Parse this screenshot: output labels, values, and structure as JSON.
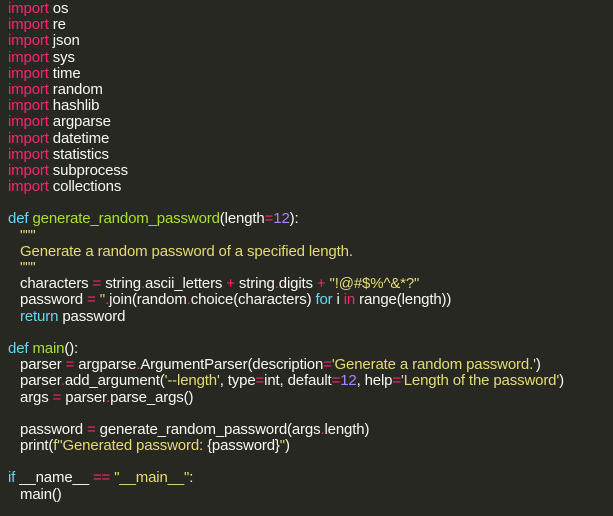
{
  "colors": {
    "background": "#272822",
    "text": "#f8f8f2",
    "keyword": "#f92672",
    "storage": "#66d9ef",
    "function": "#a6e22e",
    "number": "#ae81ff",
    "string": "#e6db74"
  },
  "lines": [
    {
      "indent": 0,
      "tokens": [
        [
          "kw",
          "import"
        ],
        [
          "tx",
          " os"
        ]
      ]
    },
    {
      "indent": 0,
      "tokens": [
        [
          "kw",
          "import"
        ],
        [
          "tx",
          " re"
        ]
      ]
    },
    {
      "indent": 0,
      "tokens": [
        [
          "kw",
          "import"
        ],
        [
          "tx",
          " json"
        ]
      ]
    },
    {
      "indent": 0,
      "tokens": [
        [
          "kw",
          "import"
        ],
        [
          "tx",
          " sys"
        ]
      ]
    },
    {
      "indent": 0,
      "tokens": [
        [
          "kw",
          "import"
        ],
        [
          "tx",
          " time"
        ]
      ]
    },
    {
      "indent": 0,
      "tokens": [
        [
          "kw",
          "import"
        ],
        [
          "tx",
          " random"
        ]
      ]
    },
    {
      "indent": 0,
      "tokens": [
        [
          "kw",
          "import"
        ],
        [
          "tx",
          " hashlib"
        ]
      ]
    },
    {
      "indent": 0,
      "tokens": [
        [
          "kw",
          "import"
        ],
        [
          "tx",
          " argparse"
        ]
      ]
    },
    {
      "indent": 0,
      "tokens": [
        [
          "kw",
          "import"
        ],
        [
          "tx",
          " datetime"
        ]
      ]
    },
    {
      "indent": 0,
      "tokens": [
        [
          "kw",
          "import"
        ],
        [
          "tx",
          " statistics"
        ]
      ]
    },
    {
      "indent": 0,
      "tokens": [
        [
          "kw",
          "import"
        ],
        [
          "tx",
          " subprocess"
        ]
      ]
    },
    {
      "indent": 0,
      "tokens": [
        [
          "kw",
          "import"
        ],
        [
          "tx",
          " collections"
        ]
      ]
    },
    {
      "indent": 0,
      "tokens": []
    },
    {
      "indent": 0,
      "tokens": [
        [
          "def",
          "def"
        ],
        [
          "tx",
          " "
        ],
        [
          "fn",
          "generate_random_password"
        ],
        [
          "tx",
          "(length"
        ],
        [
          "op",
          "="
        ],
        [
          "num",
          "12"
        ],
        [
          "tx",
          "):"
        ]
      ]
    },
    {
      "indent": 1,
      "tokens": [
        [
          "str",
          "\"\"\""
        ]
      ]
    },
    {
      "indent": 1,
      "tokens": [
        [
          "str",
          "Generate a random password of a specified length."
        ]
      ]
    },
    {
      "indent": 1,
      "tokens": [
        [
          "str",
          "\"\"\""
        ]
      ]
    },
    {
      "indent": 1,
      "tokens": [
        [
          "tx",
          "characters "
        ],
        [
          "op",
          "="
        ],
        [
          "tx",
          " string"
        ],
        [
          "op",
          "."
        ],
        [
          "tx",
          "ascii_letters "
        ],
        [
          "op",
          "+"
        ],
        [
          "tx",
          " string"
        ],
        [
          "op",
          "."
        ],
        [
          "tx",
          "digits "
        ],
        [
          "op",
          "+"
        ],
        [
          "tx",
          " "
        ],
        [
          "str",
          "\"!@#$%^&*?\""
        ]
      ]
    },
    {
      "indent": 1,
      "tokens": [
        [
          "tx",
          "password "
        ],
        [
          "op",
          "="
        ],
        [
          "tx",
          " "
        ],
        [
          "str",
          "''"
        ],
        [
          "op",
          "."
        ],
        [
          "tx",
          "join(random"
        ],
        [
          "op",
          "."
        ],
        [
          "tx",
          "choice(characters) "
        ],
        [
          "def",
          "for"
        ],
        [
          "tx",
          " i "
        ],
        [
          "kw",
          "in"
        ],
        [
          "tx",
          " range(length))"
        ]
      ]
    },
    {
      "indent": 1,
      "tokens": [
        [
          "def",
          "return"
        ],
        [
          "tx",
          " password"
        ]
      ]
    },
    {
      "indent": 0,
      "tokens": []
    },
    {
      "indent": 0,
      "tokens": [
        [
          "def",
          "def"
        ],
        [
          "tx",
          " "
        ],
        [
          "fn",
          "main"
        ],
        [
          "tx",
          "():"
        ]
      ]
    },
    {
      "indent": 1,
      "tokens": [
        [
          "tx",
          "parser "
        ],
        [
          "op",
          "="
        ],
        [
          "tx",
          " argparse"
        ],
        [
          "op",
          "."
        ],
        [
          "tx",
          "ArgumentParser(description"
        ],
        [
          "op",
          "="
        ],
        [
          "str",
          "'Generate a random password.'"
        ],
        [
          "tx",
          ")"
        ]
      ]
    },
    {
      "indent": 1,
      "tokens": [
        [
          "tx",
          "parser"
        ],
        [
          "op",
          "."
        ],
        [
          "tx",
          "add_argument("
        ],
        [
          "str",
          "'--length'"
        ],
        [
          "tx",
          ", type"
        ],
        [
          "op",
          "="
        ],
        [
          "tx",
          "int, default"
        ],
        [
          "op",
          "="
        ],
        [
          "num",
          "12"
        ],
        [
          "tx",
          ", help"
        ],
        [
          "op",
          "="
        ],
        [
          "str",
          "'Length of the password'"
        ],
        [
          "tx",
          ")"
        ]
      ]
    },
    {
      "indent": 1,
      "tokens": [
        [
          "tx",
          "args "
        ],
        [
          "op",
          "="
        ],
        [
          "tx",
          " parser"
        ],
        [
          "op",
          "."
        ],
        [
          "tx",
          "parse_args()"
        ]
      ]
    },
    {
      "indent": 0,
      "tokens": []
    },
    {
      "indent": 1,
      "tokens": [
        [
          "tx",
          "password "
        ],
        [
          "op",
          "="
        ],
        [
          "tx",
          " generate_random_password(args"
        ],
        [
          "op",
          "."
        ],
        [
          "tx",
          "length)"
        ]
      ]
    },
    {
      "indent": 1,
      "tokens": [
        [
          "tx",
          "print("
        ],
        [
          "str",
          "f\"Generated password: "
        ],
        [
          "tx",
          "{password}"
        ],
        [
          "str",
          "\""
        ],
        [
          "tx",
          ")"
        ]
      ]
    },
    {
      "indent": 0,
      "tokens": []
    },
    {
      "indent": 0,
      "tokens": [
        [
          "def",
          "if"
        ],
        [
          "tx",
          " __name__ "
        ],
        [
          "op",
          "=="
        ],
        [
          "tx",
          " "
        ],
        [
          "str",
          "\"__main__\""
        ],
        [
          "tx",
          ":"
        ]
      ]
    },
    {
      "indent": 1,
      "tokens": [
        [
          "tx",
          "main()"
        ]
      ]
    }
  ]
}
